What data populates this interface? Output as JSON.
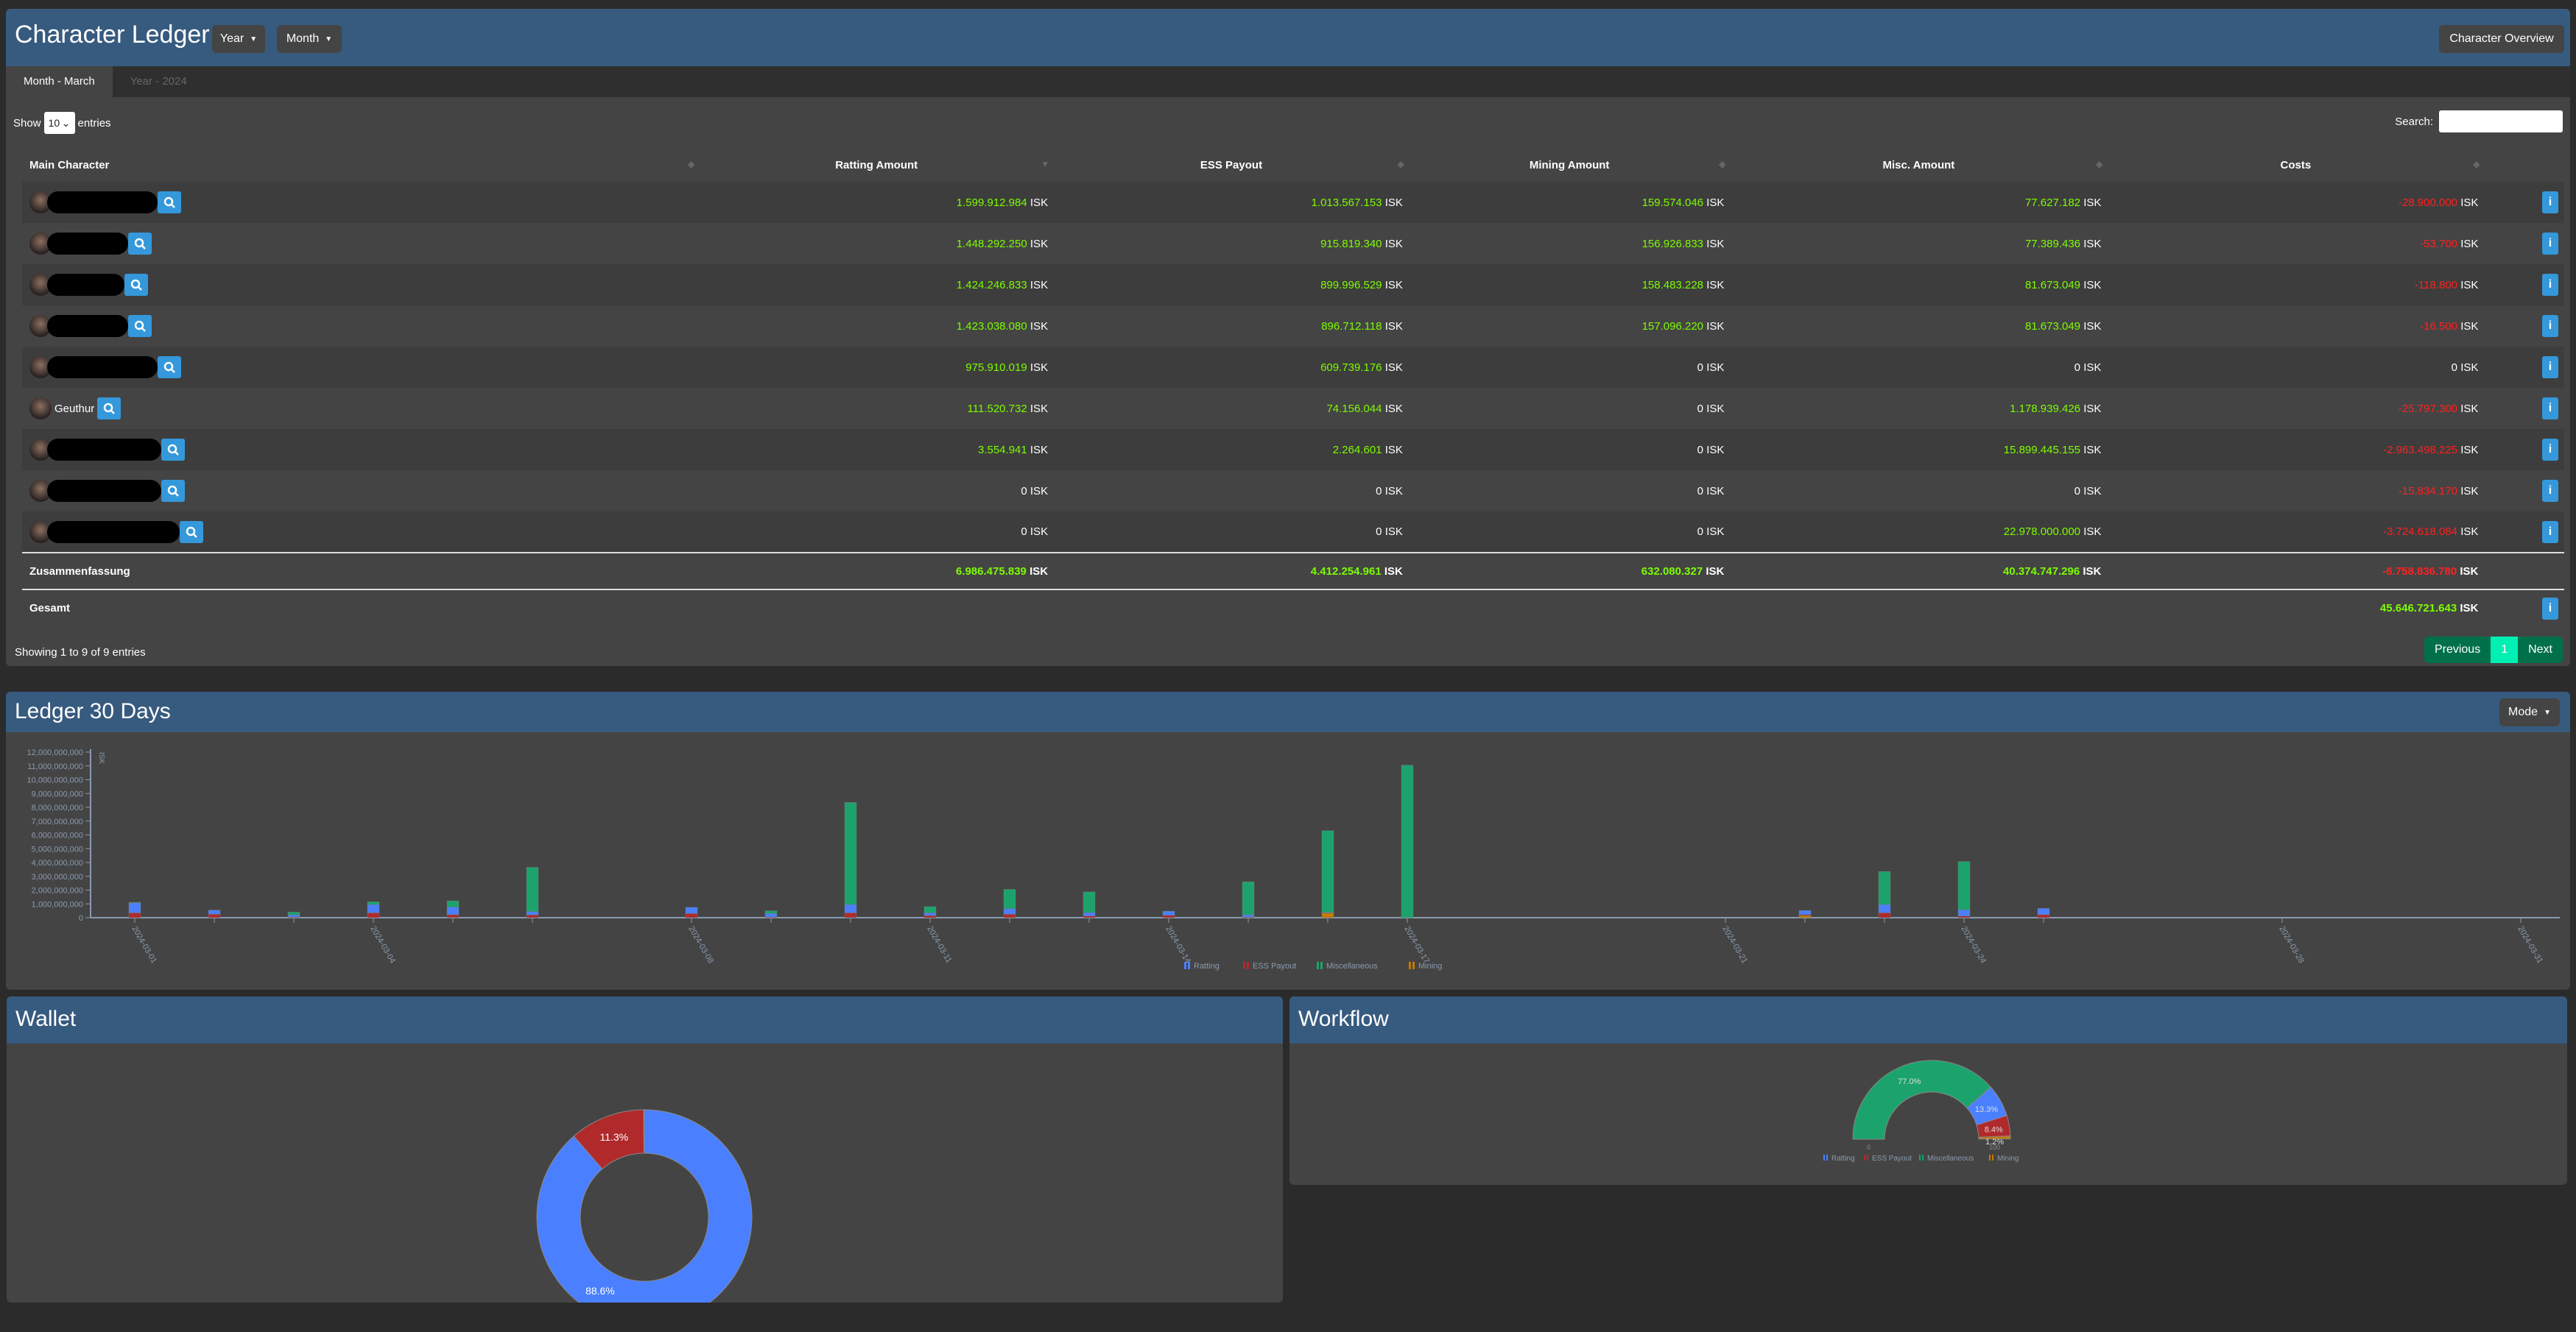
{
  "header": {
    "title": "Character Ledger",
    "year_btn": "Year",
    "month_btn": "Month",
    "overview_btn": "Character Overview"
  },
  "tabs": [
    {
      "label": "Month - March",
      "active": true
    },
    {
      "label": "Year - 2024",
      "active": false
    }
  ],
  "table_controls": {
    "show": "Show",
    "entries_value": "10",
    "entries": "entries",
    "search_label": "Search:",
    "search_value": ""
  },
  "columns": [
    "Main Character",
    "Ratting Amount",
    "ESS Payout",
    "Mining Amount",
    "Misc. Amount",
    "Costs"
  ],
  "currency": "ISK",
  "rows": [
    {
      "name": null,
      "redacted": true,
      "ratting": "1.599.912.984",
      "ess": "1.013.567.153",
      "mining": "159.574.046",
      "misc": "77.627.182",
      "costs": "-28.900.000"
    },
    {
      "name": null,
      "redacted": true,
      "ratting": "1.448.292.250",
      "ess": "915.819.340",
      "mining": "156.926.833",
      "misc": "77.389.436",
      "costs": "-53.700"
    },
    {
      "name": null,
      "redacted": true,
      "ratting": "1.424.246.833",
      "ess": "899.996.529",
      "mining": "158.483.228",
      "misc": "81.673.049",
      "costs": "-118.800"
    },
    {
      "name": null,
      "redacted": true,
      "ratting": "1.423.038.080",
      "ess": "896.712.118",
      "mining": "157.096.220",
      "misc": "81.673.049",
      "costs": "-16.500"
    },
    {
      "name": null,
      "redacted": true,
      "ratting": "975.910.019",
      "ess": "609.739.176",
      "mining": "0",
      "misc": "0",
      "costs": "0"
    },
    {
      "name": "Geuthur",
      "redacted": false,
      "ratting": "111.520.732",
      "ess": "74.156.044",
      "mining": "0",
      "misc": "1.178.939.426",
      "costs": "-25.797.300"
    },
    {
      "name": null,
      "redacted": true,
      "ratting": "3.554.941",
      "ess": "2.264.601",
      "mining": "0",
      "misc": "15.899.445.155",
      "costs": "-2.963.498.225"
    },
    {
      "name": null,
      "redacted": true,
      "ratting": "0",
      "ess": "0",
      "mining": "0",
      "misc": "0",
      "costs": "-15.834.170"
    },
    {
      "name": null,
      "redacted": true,
      "ratting": "0",
      "ess": "0",
      "mining": "0",
      "misc": "22.978.000.000",
      "costs": "-3.724.618.084"
    }
  ],
  "summary": {
    "label": "Zusammenfassung",
    "ratting": "6.986.475.839",
    "ess": "4.412.254.961",
    "mining": "632.080.327",
    "misc": "40.374.747.296",
    "costs": "-6.758.836.780"
  },
  "total": {
    "label": "Gesamt",
    "value": "45.646.721.643"
  },
  "footer": {
    "showing": "Showing 1 to 9 of 9 entries",
    "prev": "Previous",
    "page": "1",
    "next": "Next"
  },
  "ledger": {
    "title": "Ledger 30 Days",
    "mode_btn": "Mode"
  },
  "wallet": {
    "title": "Wallet"
  },
  "workflow": {
    "title": "Workflow"
  },
  "colors": {
    "ratting": "#4a80ff",
    "ess": "#b0292b",
    "misc": "#1ca36c",
    "mining": "#c47a00",
    "positive": "#7cfc00",
    "negative": "#ff2020",
    "header": "#375a7f"
  },
  "chart_data": [
    {
      "type": "bar",
      "stacked": true,
      "title": "",
      "ylabel": "ISK",
      "ylim": [
        0,
        12000000000
      ],
      "yticks": [
        "0",
        "1,000,000,000",
        "2,000,000,000",
        "3,000,000,000",
        "4,000,000,000",
        "5,000,000,000",
        "6,000,000,000",
        "7,000,000,000",
        "8,000,000,000",
        "9,000,000,000",
        "10,000,000,000",
        "11,000,000,000",
        "12,000,000,000"
      ],
      "xticks": [
        "2024-03-01",
        "2024-03-04",
        "2024-03-08",
        "2024-03-11",
        "2024-03-14",
        "2024-03-17",
        "2024-03-21",
        "2024-03-24",
        "2024-03-28",
        "2024-03-31"
      ],
      "legend": [
        "Ratting",
        "ESS Payout",
        "Miscellaneous",
        "Mining"
      ],
      "legend_position": "bottom",
      "x": [
        "2024-03-01",
        "2024-03-02",
        "2024-03-03",
        "2024-03-04",
        "2024-03-05",
        "2024-03-06",
        "2024-03-08",
        "2024-03-09",
        "2024-03-10",
        "2024-03-11",
        "2024-03-12",
        "2024-03-13",
        "2024-03-14",
        "2024-03-15",
        "2024-03-16",
        "2024-03-17",
        "2024-03-22",
        "2024-03-23",
        "2024-03-24",
        "2024-03-25"
      ],
      "series": [
        {
          "name": "Mining",
          "key": "mining",
          "values": [
            0,
            0,
            0,
            0,
            0.02,
            0,
            0,
            0,
            0,
            0,
            0,
            0,
            0,
            0,
            0.35,
            0,
            0.15,
            0,
            0,
            0
          ]
        },
        {
          "name": "ESS Payout",
          "key": "ess",
          "values": [
            0.35,
            0.25,
            0.05,
            0.35,
            0.2,
            0.2,
            0.3,
            0.05,
            0.35,
            0.15,
            0.25,
            0.12,
            0.17,
            0.05,
            0,
            0,
            0.07,
            0.35,
            0.12,
            0.22
          ]
        },
        {
          "name": "Ratting",
          "key": "ratting",
          "values": [
            0.72,
            0.3,
            0.15,
            0.6,
            0.55,
            0.25,
            0.45,
            0.25,
            0.6,
            0.2,
            0.4,
            0.25,
            0.3,
            0.15,
            0.05,
            0,
            0.3,
            0.6,
            0.45,
            0.45
          ]
        },
        {
          "name": "Miscellaneous",
          "key": "misc",
          "values": [
            0.05,
            0,
            0.2,
            0.2,
            0.45,
            3.2,
            0,
            0.2,
            7.4,
            0.45,
            1.4,
            1.5,
            0,
            2.4,
            5.9,
            11.05,
            0,
            2.4,
            3.5,
            0
          ]
        }
      ],
      "value_unit": "billion ISK"
    },
    {
      "type": "pie",
      "variant": "donut",
      "slices": [
        {
          "key": "ratting",
          "value": 88.6,
          "label": "88.6%"
        },
        {
          "key": "ess",
          "value": 11.3,
          "label": "11.3%"
        },
        {
          "key": "other",
          "value": 0.1,
          "label": ""
        }
      ]
    },
    {
      "type": "pie",
      "variant": "gauge",
      "range": [
        "0",
        "100"
      ],
      "legend": [
        "Ratting",
        "ESS Payout",
        "Miscellaneous",
        "Mining"
      ],
      "slices": [
        {
          "key": "misc",
          "value": 77.0,
          "label": "77.0%"
        },
        {
          "key": "ratting",
          "value": 13.3,
          "label": "13.3%"
        },
        {
          "key": "ess",
          "value": 8.4,
          "label": "8.4%"
        },
        {
          "key": "mining",
          "value": 1.2,
          "label": "1.2%"
        }
      ]
    }
  ]
}
